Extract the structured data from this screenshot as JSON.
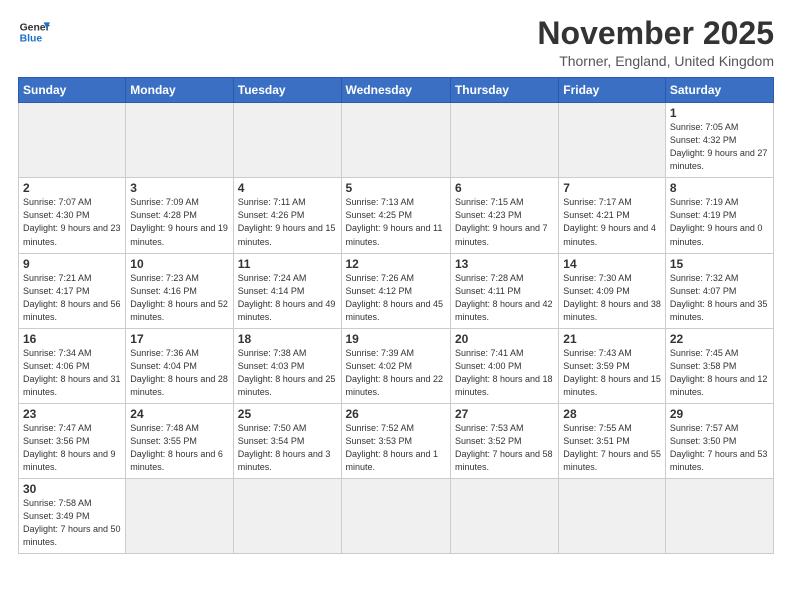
{
  "header": {
    "logo_general": "General",
    "logo_blue": "Blue",
    "month_title": "November 2025",
    "subtitle": "Thorner, England, United Kingdom"
  },
  "weekdays": [
    "Sunday",
    "Monday",
    "Tuesday",
    "Wednesday",
    "Thursday",
    "Friday",
    "Saturday"
  ],
  "weeks": [
    [
      {
        "day": "",
        "empty": true
      },
      {
        "day": "",
        "empty": true
      },
      {
        "day": "",
        "empty": true
      },
      {
        "day": "",
        "empty": true
      },
      {
        "day": "",
        "empty": true
      },
      {
        "day": "",
        "empty": true
      },
      {
        "day": "1",
        "sunrise": "Sunrise: 7:05 AM",
        "sunset": "Sunset: 4:32 PM",
        "daylight": "Daylight: 9 hours and 27 minutes."
      }
    ],
    [
      {
        "day": "2",
        "sunrise": "Sunrise: 7:07 AM",
        "sunset": "Sunset: 4:30 PM",
        "daylight": "Daylight: 9 hours and 23 minutes."
      },
      {
        "day": "3",
        "sunrise": "Sunrise: 7:09 AM",
        "sunset": "Sunset: 4:28 PM",
        "daylight": "Daylight: 9 hours and 19 minutes."
      },
      {
        "day": "4",
        "sunrise": "Sunrise: 7:11 AM",
        "sunset": "Sunset: 4:26 PM",
        "daylight": "Daylight: 9 hours and 15 minutes."
      },
      {
        "day": "5",
        "sunrise": "Sunrise: 7:13 AM",
        "sunset": "Sunset: 4:25 PM",
        "daylight": "Daylight: 9 hours and 11 minutes."
      },
      {
        "day": "6",
        "sunrise": "Sunrise: 7:15 AM",
        "sunset": "Sunset: 4:23 PM",
        "daylight": "Daylight: 9 hours and 7 minutes."
      },
      {
        "day": "7",
        "sunrise": "Sunrise: 7:17 AM",
        "sunset": "Sunset: 4:21 PM",
        "daylight": "Daylight: 9 hours and 4 minutes."
      },
      {
        "day": "8",
        "sunrise": "Sunrise: 7:19 AM",
        "sunset": "Sunset: 4:19 PM",
        "daylight": "Daylight: 9 hours and 0 minutes."
      }
    ],
    [
      {
        "day": "9",
        "sunrise": "Sunrise: 7:21 AM",
        "sunset": "Sunset: 4:17 PM",
        "daylight": "Daylight: 8 hours and 56 minutes."
      },
      {
        "day": "10",
        "sunrise": "Sunrise: 7:23 AM",
        "sunset": "Sunset: 4:16 PM",
        "daylight": "Daylight: 8 hours and 52 minutes."
      },
      {
        "day": "11",
        "sunrise": "Sunrise: 7:24 AM",
        "sunset": "Sunset: 4:14 PM",
        "daylight": "Daylight: 8 hours and 49 minutes."
      },
      {
        "day": "12",
        "sunrise": "Sunrise: 7:26 AM",
        "sunset": "Sunset: 4:12 PM",
        "daylight": "Daylight: 8 hours and 45 minutes."
      },
      {
        "day": "13",
        "sunrise": "Sunrise: 7:28 AM",
        "sunset": "Sunset: 4:11 PM",
        "daylight": "Daylight: 8 hours and 42 minutes."
      },
      {
        "day": "14",
        "sunrise": "Sunrise: 7:30 AM",
        "sunset": "Sunset: 4:09 PM",
        "daylight": "Daylight: 8 hours and 38 minutes."
      },
      {
        "day": "15",
        "sunrise": "Sunrise: 7:32 AM",
        "sunset": "Sunset: 4:07 PM",
        "daylight": "Daylight: 8 hours and 35 minutes."
      }
    ],
    [
      {
        "day": "16",
        "sunrise": "Sunrise: 7:34 AM",
        "sunset": "Sunset: 4:06 PM",
        "daylight": "Daylight: 8 hours and 31 minutes."
      },
      {
        "day": "17",
        "sunrise": "Sunrise: 7:36 AM",
        "sunset": "Sunset: 4:04 PM",
        "daylight": "Daylight: 8 hours and 28 minutes."
      },
      {
        "day": "18",
        "sunrise": "Sunrise: 7:38 AM",
        "sunset": "Sunset: 4:03 PM",
        "daylight": "Daylight: 8 hours and 25 minutes."
      },
      {
        "day": "19",
        "sunrise": "Sunrise: 7:39 AM",
        "sunset": "Sunset: 4:02 PM",
        "daylight": "Daylight: 8 hours and 22 minutes."
      },
      {
        "day": "20",
        "sunrise": "Sunrise: 7:41 AM",
        "sunset": "Sunset: 4:00 PM",
        "daylight": "Daylight: 8 hours and 18 minutes."
      },
      {
        "day": "21",
        "sunrise": "Sunrise: 7:43 AM",
        "sunset": "Sunset: 3:59 PM",
        "daylight": "Daylight: 8 hours and 15 minutes."
      },
      {
        "day": "22",
        "sunrise": "Sunrise: 7:45 AM",
        "sunset": "Sunset: 3:58 PM",
        "daylight": "Daylight: 8 hours and 12 minutes."
      }
    ],
    [
      {
        "day": "23",
        "sunrise": "Sunrise: 7:47 AM",
        "sunset": "Sunset: 3:56 PM",
        "daylight": "Daylight: 8 hours and 9 minutes."
      },
      {
        "day": "24",
        "sunrise": "Sunrise: 7:48 AM",
        "sunset": "Sunset: 3:55 PM",
        "daylight": "Daylight: 8 hours and 6 minutes."
      },
      {
        "day": "25",
        "sunrise": "Sunrise: 7:50 AM",
        "sunset": "Sunset: 3:54 PM",
        "daylight": "Daylight: 8 hours and 3 minutes."
      },
      {
        "day": "26",
        "sunrise": "Sunrise: 7:52 AM",
        "sunset": "Sunset: 3:53 PM",
        "daylight": "Daylight: 8 hours and 1 minute."
      },
      {
        "day": "27",
        "sunrise": "Sunrise: 7:53 AM",
        "sunset": "Sunset: 3:52 PM",
        "daylight": "Daylight: 7 hours and 58 minutes."
      },
      {
        "day": "28",
        "sunrise": "Sunrise: 7:55 AM",
        "sunset": "Sunset: 3:51 PM",
        "daylight": "Daylight: 7 hours and 55 minutes."
      },
      {
        "day": "29",
        "sunrise": "Sunrise: 7:57 AM",
        "sunset": "Sunset: 3:50 PM",
        "daylight": "Daylight: 7 hours and 53 minutes."
      }
    ],
    [
      {
        "day": "30",
        "sunrise": "Sunrise: 7:58 AM",
        "sunset": "Sunset: 3:49 PM",
        "daylight": "Daylight: 7 hours and 50 minutes."
      },
      {
        "day": "",
        "empty": true
      },
      {
        "day": "",
        "empty": true
      },
      {
        "day": "",
        "empty": true
      },
      {
        "day": "",
        "empty": true
      },
      {
        "day": "",
        "empty": true
      },
      {
        "day": "",
        "empty": true
      }
    ]
  ]
}
